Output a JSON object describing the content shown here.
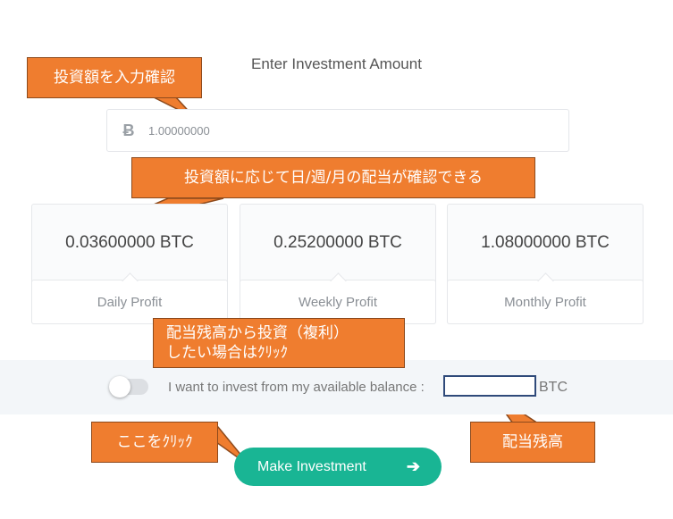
{
  "heading": "Enter Investment Amount",
  "amount": {
    "currency_icon": "Ƀ",
    "value": "1.00000000"
  },
  "cards": [
    {
      "value": "0.03600000 BTC",
      "label": "Daily Profit"
    },
    {
      "value": "0.25200000 BTC",
      "label": "Weekly Profit"
    },
    {
      "value": "1.08000000 BTC",
      "label": "Monthly Profit"
    }
  ],
  "balance_option": {
    "label": "I want to invest from my available balance :",
    "value": "",
    "unit": "BTC"
  },
  "make_investment": {
    "label": "Make Investment",
    "arrow": "➔"
  },
  "callouts": {
    "confirm_amount": "投資額を入力確認",
    "profit_info": "投資額に応じて日/週/月の配当が確認できる",
    "compound_line1": "配当残高から投資（複利）",
    "compound_line2": "したい場合はｸﾘｯｸ",
    "click_here": "ここをｸﾘｯｸ",
    "balance": "配当残高"
  },
  "colors": {
    "accent": "#19b594",
    "callout": "#ef7d2f",
    "callout_border": "#8d4a1c",
    "balance_box_border": "#2f4a7a"
  }
}
